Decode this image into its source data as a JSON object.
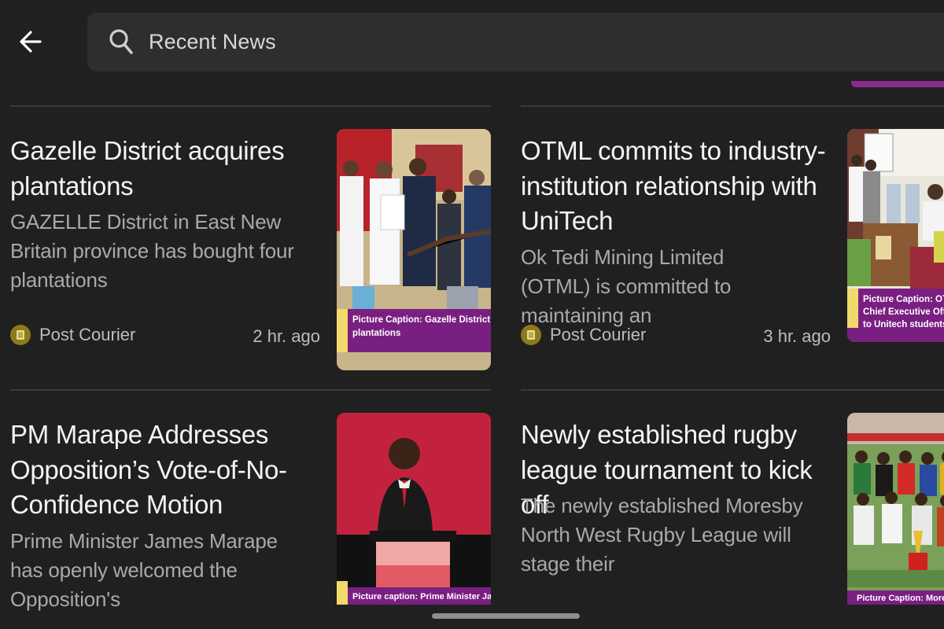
{
  "search": {
    "query": "Recent News"
  },
  "articles": [
    {
      "title": "Gazelle District acquires plantations",
      "snippet": "GAZELLE District in East New Britain province has bought four plantations",
      "source": "Post Courier",
      "time": "2 hr. ago",
      "caption": "Picture Caption: Gazelle District acqui",
      "caption_line2": "plantations"
    },
    {
      "title": "OTML commits to industry-institution relationship with UniTech",
      "snippet": "Ok Tedi Mining Limited (OTML) is committed to maintaining an",
      "source": "Post Courier",
      "time": "3 hr. ago",
      "caption": "Picture Caption:  OTML",
      "caption_line2": "Chief Executive Officer",
      "caption_line3": "to Unitech students du"
    },
    {
      "title": "PM Marape Addresses Opposition’s Vote-of-No-Confidence Motion",
      "snippet": "Prime Minister James Marape has openly welcomed the Opposition's",
      "caption": "Picture caption: Prime Minister James Marap"
    },
    {
      "title": "Newly established rugby league tournament to kick off",
      "snippet": "The newly established Moresby North West Rugby League will stage their",
      "caption": "Picture Caption: Moresby N"
    }
  ],
  "colors": {
    "background": "#202020",
    "search_bg": "#2e2e2e",
    "caption_purple": "#7a1f82",
    "source_badge": "#8c7a1c"
  }
}
